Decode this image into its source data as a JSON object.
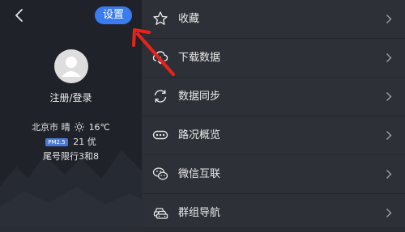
{
  "header": {
    "settings_label": "设置"
  },
  "profile": {
    "login_label": "注册/登录"
  },
  "weather": {
    "city": "北京市",
    "condition": "晴",
    "temperature": "16℃",
    "pm_badge": "PM2.5",
    "pm_value": "21 优",
    "traffic_limit": "尾号限行3和8"
  },
  "menu": {
    "items": [
      {
        "label": "收藏",
        "icon": "star-icon"
      },
      {
        "label": "下载数据",
        "icon": "cloud-download-icon"
      },
      {
        "label": "数据同步",
        "icon": "sync-icon"
      },
      {
        "label": "路况概览",
        "icon": "traffic-overview-icon"
      },
      {
        "label": "微信互联",
        "icon": "wechat-icon"
      },
      {
        "label": "群组导航",
        "icon": "group-navigation-icon"
      }
    ]
  },
  "colors": {
    "accent": "#3a7bf1",
    "annotation_arrow": "#e8231b"
  }
}
